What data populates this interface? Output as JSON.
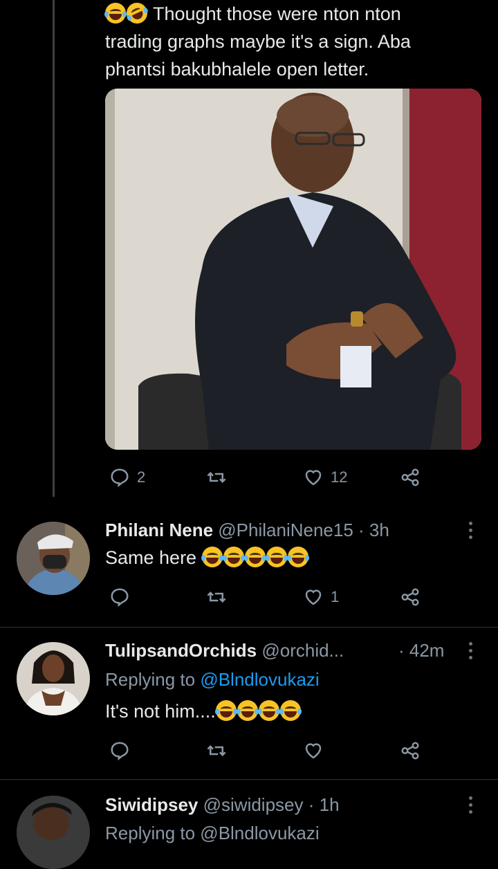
{
  "tweet": {
    "text_line1": "Thought those were nton nton",
    "text_line2": "trading graphs maybe it's a sign. Aba",
    "text_line3": "phantsi bakubhalele open letter.",
    "emojis": [
      "face-with-tears-of-joy",
      "rolling-on-floor-laughing"
    ],
    "actions": {
      "replies": "2",
      "retweets": "",
      "likes": "12"
    }
  },
  "replies": [
    {
      "name": "Philani Nene",
      "handle": "@PhilaniNene15",
      "time": "· 3h",
      "text": "Same here",
      "emoji_count": 5,
      "actions": {
        "replies": "",
        "retweets": "",
        "likes": "1"
      }
    },
    {
      "name": "TulipsandOrchids",
      "handle": "@orchid...",
      "time": "· 42m",
      "replying_prefix": "Replying to",
      "replying_to": "@Blndlovukazi",
      "text": "It's not him....",
      "emoji_count": 4,
      "actions": {
        "replies": "",
        "retweets": "",
        "likes": ""
      }
    },
    {
      "name": "Siwidipsey",
      "handle": "@siwidipsey",
      "time": "· 1h",
      "replying_partial": "Replying to @Blndlovukazi"
    }
  ],
  "colors": {
    "background": "#000000",
    "text": "#e7e9ea",
    "muted": "#8b98a5",
    "link": "#1d9bf0",
    "divider": "#2f3336"
  }
}
